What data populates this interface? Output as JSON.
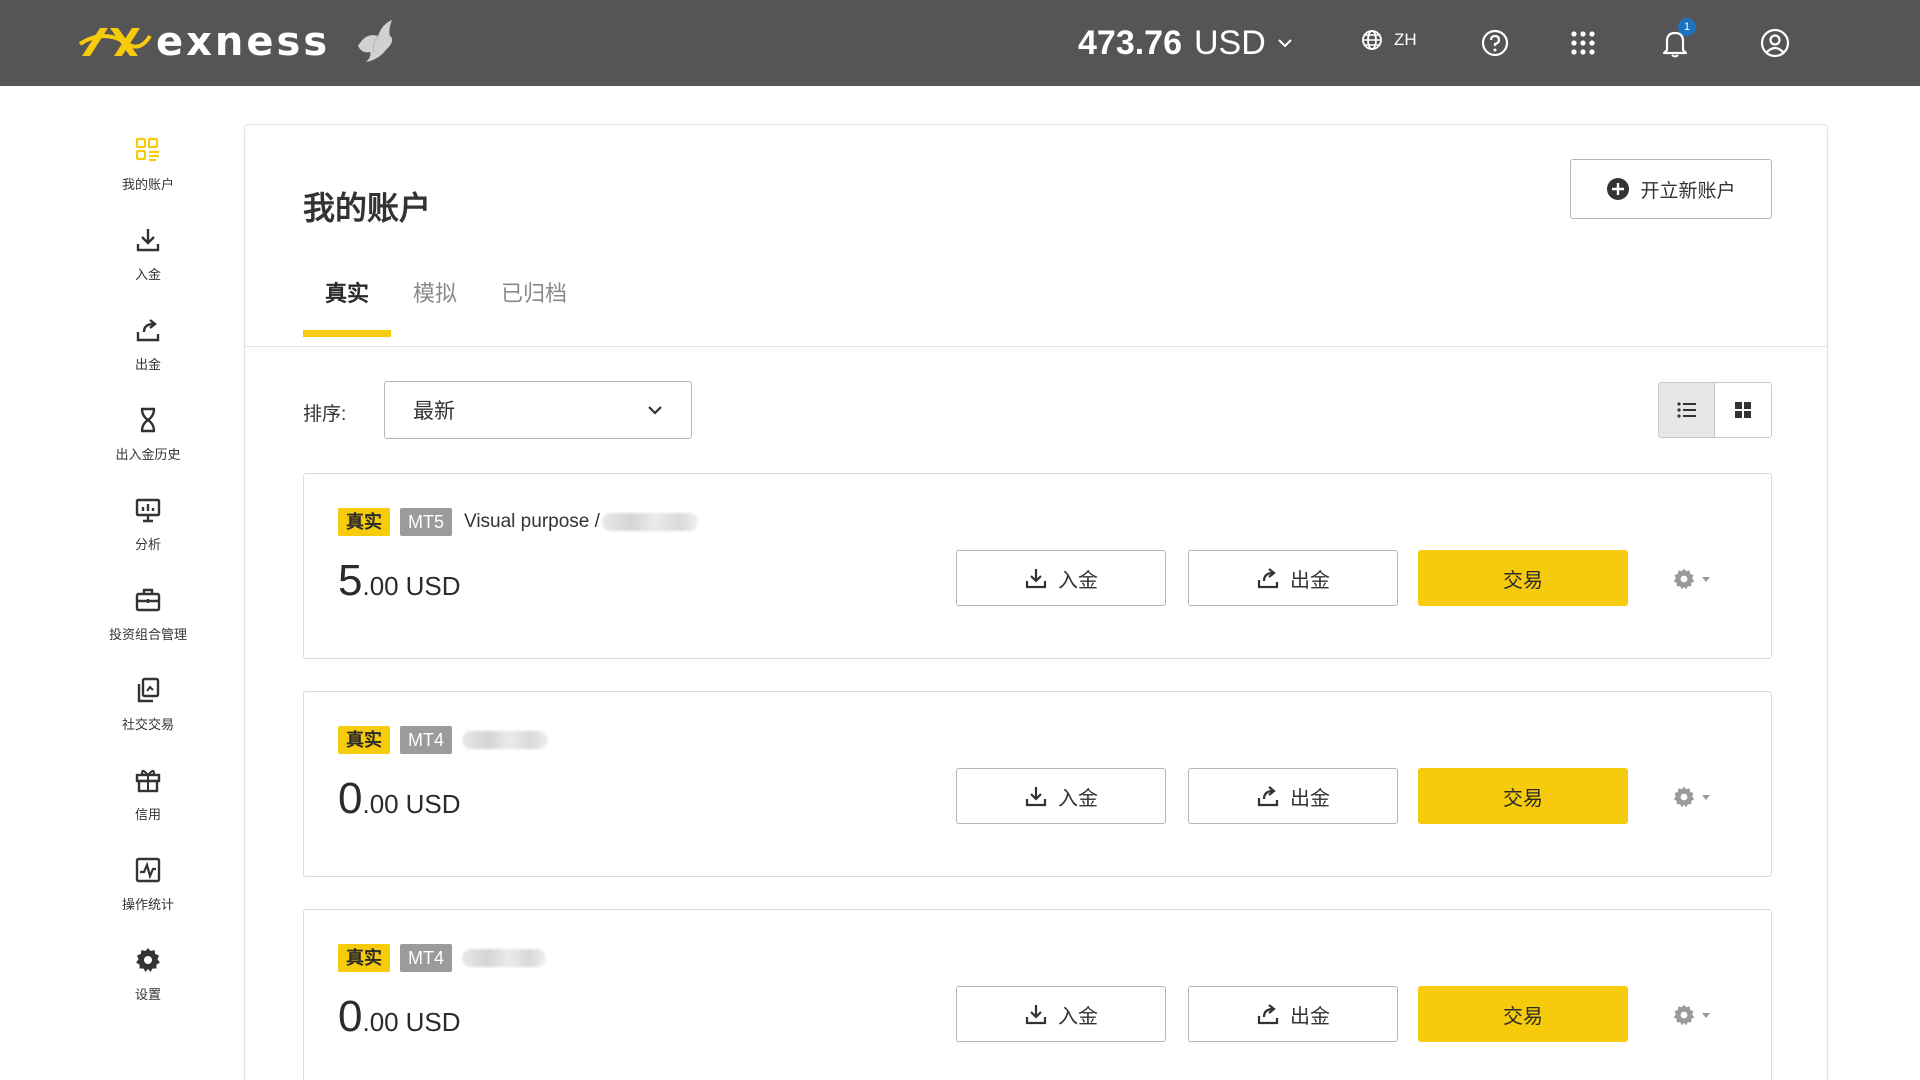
{
  "header": {
    "brand": "exness",
    "balance_amount": "473.76",
    "balance_currency": "USD",
    "language": "ZH",
    "notification_count": "1",
    "colors": {
      "bar": "#555555",
      "accent": "#f6cb0b",
      "badge": "#1e73be"
    }
  },
  "sidebar": {
    "items": [
      {
        "label": "我的账户",
        "icon": "grid-accounts-icon",
        "active": true
      },
      {
        "label": "入金",
        "icon": "download-icon"
      },
      {
        "label": "出金",
        "icon": "upload-icon"
      },
      {
        "label": "出入金历史",
        "icon": "hourglass-icon"
      },
      {
        "label": "分析",
        "icon": "presentation-chart-icon"
      },
      {
        "label": "投资组合管理",
        "icon": "briefcase-icon"
      },
      {
        "label": "社交交易",
        "icon": "copy-trading-icon"
      },
      {
        "label": "信用",
        "icon": "gift-icon"
      },
      {
        "label": "操作统计",
        "icon": "pulse-chart-icon"
      },
      {
        "label": "设置",
        "icon": "gear-icon"
      }
    ]
  },
  "main": {
    "title": "我的账户",
    "open_account_label": "开立新账户",
    "tabs": [
      {
        "label": "真实",
        "active": true
      },
      {
        "label": "模拟"
      },
      {
        "label": "已归档"
      }
    ],
    "sort_label": "排序:",
    "sort_value": "最新",
    "view_modes": [
      "list-view-icon",
      "grid-view-icon"
    ]
  },
  "accounts": [
    {
      "type_tag": "真实",
      "platform": "MT5",
      "name": "Visual purpose /",
      "balance_int": "5",
      "balance_dec": ".00",
      "currency": "USD",
      "deposit_label": "入金",
      "withdraw_label": "出金",
      "trade_label": "交易"
    },
    {
      "type_tag": "真实",
      "platform": "MT4",
      "name": "",
      "balance_int": "0",
      "balance_dec": ".00",
      "currency": "USD",
      "deposit_label": "入金",
      "withdraw_label": "出金",
      "trade_label": "交易"
    },
    {
      "type_tag": "真实",
      "platform": "MT4",
      "name": "",
      "balance_int": "0",
      "balance_dec": ".00",
      "currency": "USD",
      "deposit_label": "入金",
      "withdraw_label": "出金",
      "trade_label": "交易"
    }
  ]
}
